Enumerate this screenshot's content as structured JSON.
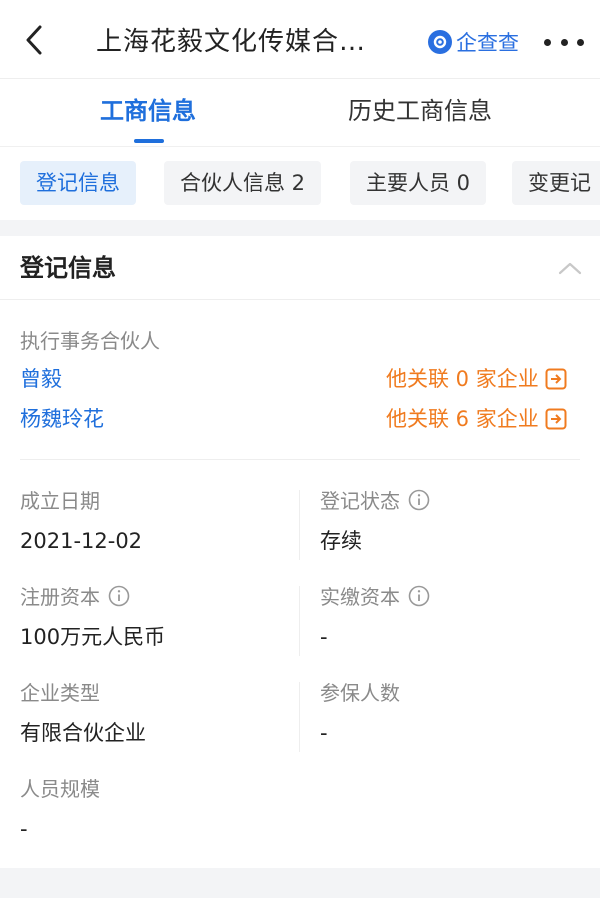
{
  "header": {
    "title": "上海花毅文化传媒合…",
    "brand": "企查查",
    "icons": {
      "back": "back-arrow-icon",
      "more": "more-icon",
      "brand": "qichacha-logo-icon"
    }
  },
  "tabs": [
    {
      "label": "工商信息",
      "active": true
    },
    {
      "label": "历史工商信息",
      "active": false
    }
  ],
  "chips": [
    {
      "label": "登记信息",
      "active": true
    },
    {
      "label": "合伙人信息 2",
      "active": false
    },
    {
      "label": "主要人员 0",
      "active": false
    },
    {
      "label": "变更记",
      "active": false
    }
  ],
  "section": {
    "title": "登记信息",
    "executive_partner": {
      "label": "执行事务合伙人",
      "partners": [
        {
          "name": "曾毅",
          "related": "他关联 0 家企业"
        },
        {
          "name": "杨魏玲花",
          "related": "他关联 6 家企业"
        }
      ]
    },
    "fields": {
      "established": {
        "label": "成立日期",
        "value": "2021-12-02"
      },
      "status": {
        "label": "登记状态",
        "value": "存续"
      },
      "registered_capital": {
        "label": "注册资本",
        "value": "100万元人民币"
      },
      "paid_capital": {
        "label": "实缴资本",
        "value": "-"
      },
      "type": {
        "label": "企业类型",
        "value": "有限合伙企业"
      },
      "insured": {
        "label": "参保人数",
        "value": "-"
      },
      "scale": {
        "label": "人员规模",
        "value": "-"
      }
    }
  },
  "colors": {
    "accent": "#1f6fdc",
    "related": "#f07b1f",
    "brand": "#2a6fe0"
  }
}
